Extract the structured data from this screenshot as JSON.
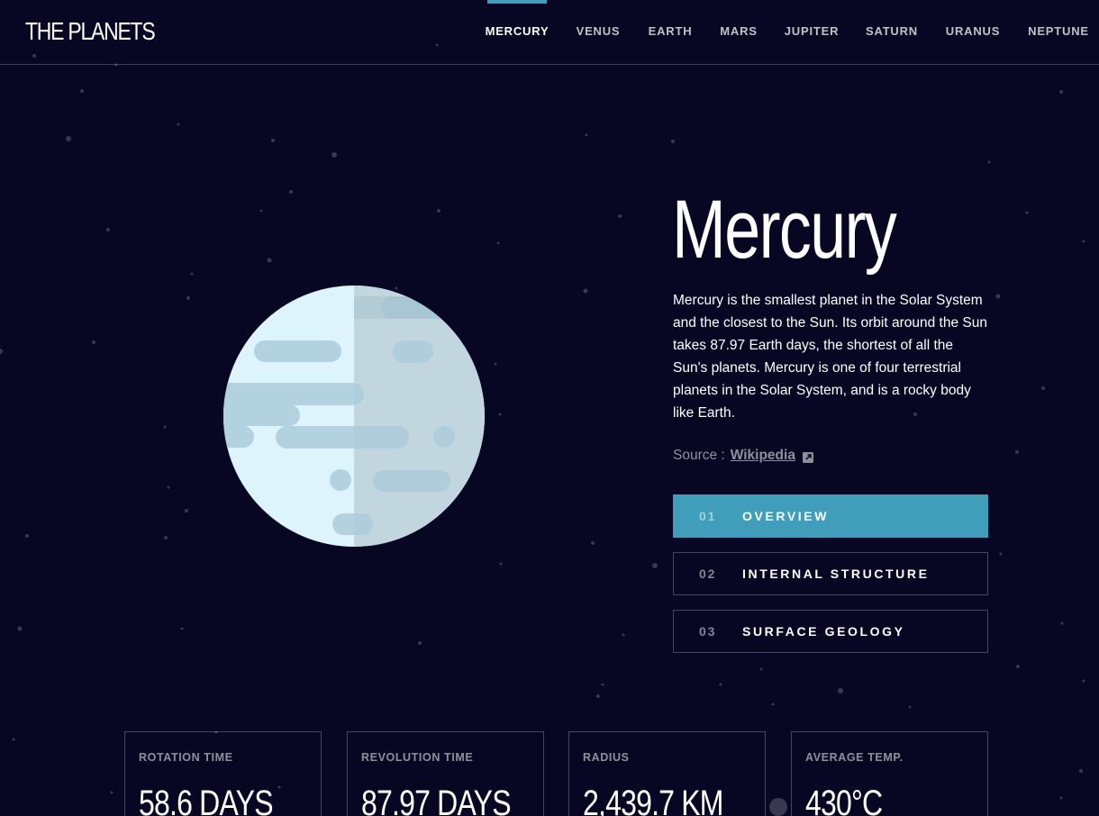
{
  "header": {
    "logo": "THE PLANETS",
    "nav": [
      {
        "label": "MERCURY",
        "active": true
      },
      {
        "label": "VENUS",
        "active": false
      },
      {
        "label": "EARTH",
        "active": false
      },
      {
        "label": "MARS",
        "active": false
      },
      {
        "label": "JUPITER",
        "active": false
      },
      {
        "label": "SATURN",
        "active": false
      },
      {
        "label": "URANUS",
        "active": false
      },
      {
        "label": "NEPTUNE",
        "active": false
      }
    ]
  },
  "planet": {
    "name": "Mercury",
    "description": "Mercury is the smallest planet in the Solar System and the closest to the Sun. Its orbit around the Sun takes 87.97 Earth days, the shortest of all the Sun's planets. Mercury is one of four terrestrial planets in the Solar System, and is a rocky body like Earth.",
    "source_label": "Source :",
    "source_link": "Wikipedia",
    "source_icon": "external-link-icon"
  },
  "tabs": [
    {
      "num": "01",
      "label": "OVERVIEW",
      "active": true
    },
    {
      "num": "02",
      "label": "INTERNAL STRUCTURE",
      "active": false
    },
    {
      "num": "03",
      "label": "SURFACE GEOLOGY",
      "active": false
    }
  ],
  "stats": [
    {
      "label": "ROTATION TIME",
      "value": "58.6 DAYS"
    },
    {
      "label": "REVOLUTION TIME",
      "value": "87.97 DAYS"
    },
    {
      "label": "RADIUS",
      "value": "2,439.7 KM"
    },
    {
      "label": "AVERAGE TEMP.",
      "value": "430°C"
    }
  ],
  "colors": {
    "background": "#070724",
    "accent": "#419ebb",
    "planet_light": "#def4fc",
    "planet_shade": "#c8dde5",
    "planet_spots": "#b2d2e0"
  }
}
